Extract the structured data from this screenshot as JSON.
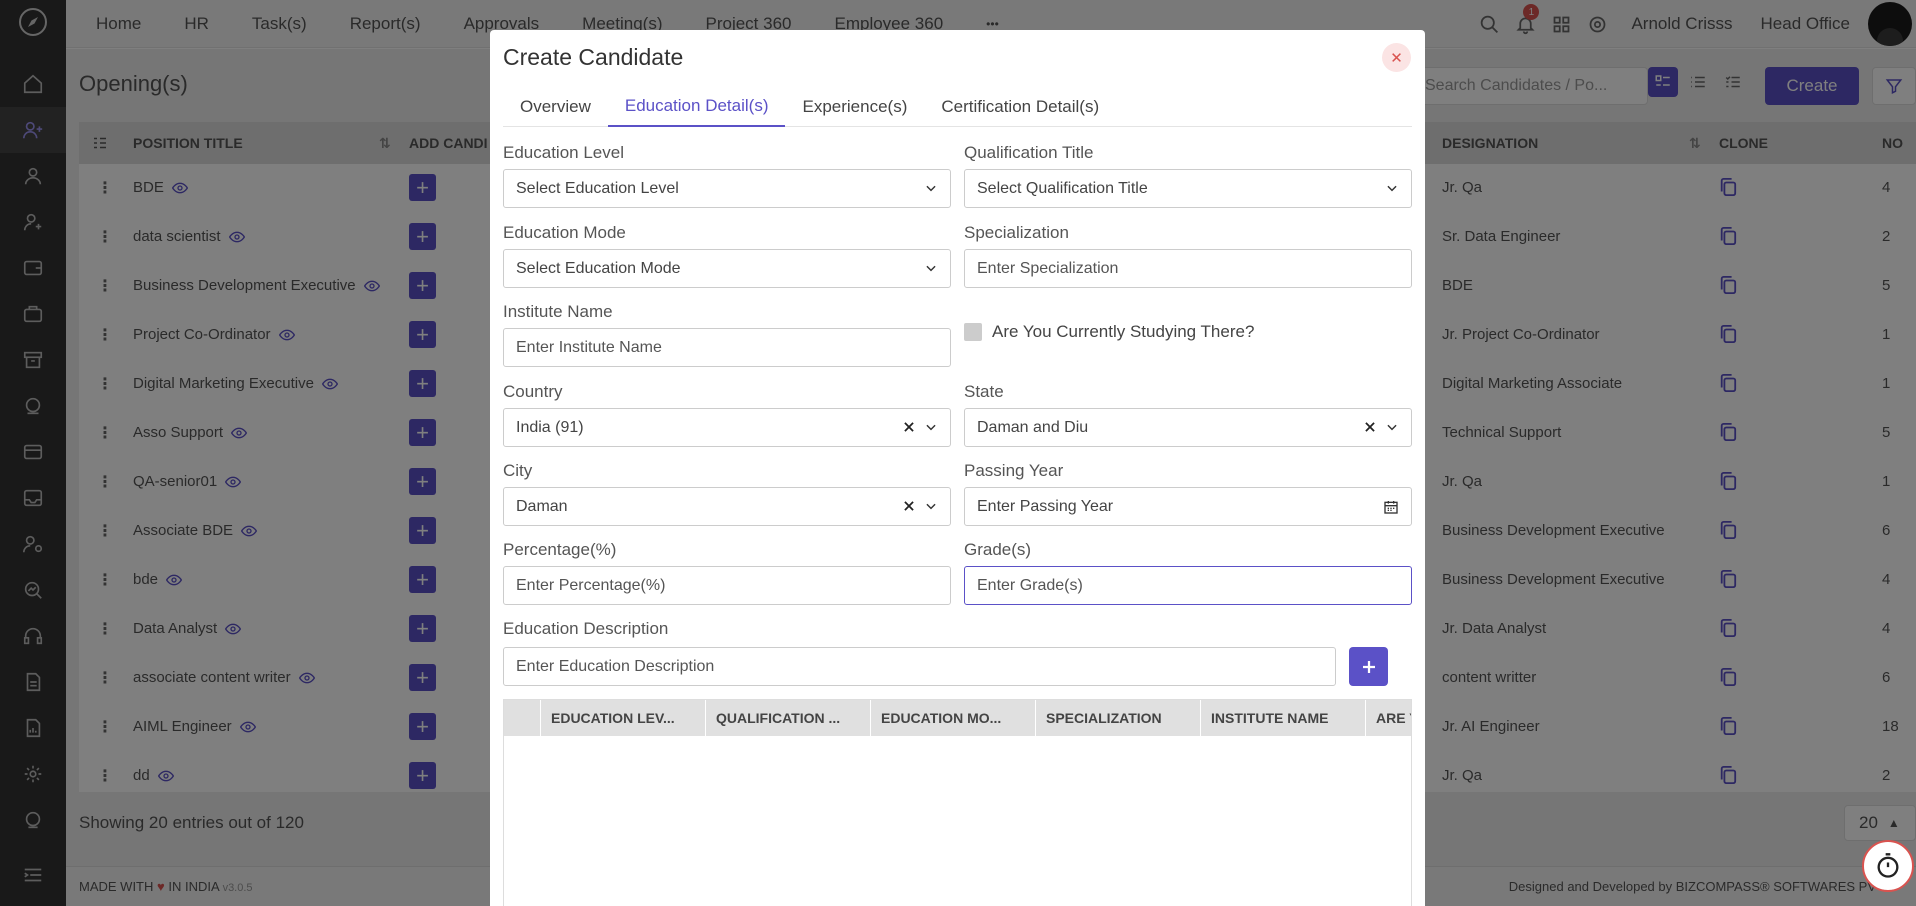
{
  "nav": {
    "items": [
      "Home",
      "HR",
      "Task(s)",
      "Report(s)",
      "Approvals",
      "Meeting(s)",
      "Project 360",
      "Employee 360"
    ],
    "more": "•••"
  },
  "user": {
    "name": "Arnold Crisss",
    "office": "Head Office",
    "notifications": "1"
  },
  "page": {
    "title": "Opening(s)",
    "search_placeholder": "Search Candidates / Po...",
    "create_label": "Create",
    "columns": {
      "position": "POSITION TITLE",
      "add": "ADD CANDI",
      "designation": "DESIGNATION",
      "clone": "CLONE",
      "num": "NO"
    },
    "rows": [
      {
        "title": "BDE",
        "designation": "Jr. Qa",
        "num": "4"
      },
      {
        "title": "data scientist",
        "designation": "Sr. Data Engineer",
        "num": "2"
      },
      {
        "title": "Business Development Executive",
        "designation": "BDE",
        "num": "5"
      },
      {
        "title": "Project Co-Ordinator",
        "designation": "Jr. Project Co-Ordinator",
        "num": "1"
      },
      {
        "title": "Digital Marketing Executive",
        "designation": "Digital Marketing Associate",
        "num": "1"
      },
      {
        "title": "Asso Support",
        "designation": "Technical Support",
        "num": "5"
      },
      {
        "title": "QA-senior01",
        "designation": "Jr. Qa",
        "num": "1"
      },
      {
        "title": "Associate BDE",
        "designation": "Business Development Executive",
        "num": "6"
      },
      {
        "title": "bde",
        "designation": "Business Development Executive",
        "num": "4"
      },
      {
        "title": "Data Analyst",
        "designation": "Jr. Data Analyst",
        "num": "4"
      },
      {
        "title": "associate content writer",
        "designation": "content writter",
        "num": "6"
      },
      {
        "title": "AIML Engineer",
        "designation": "Jr. AI Engineer",
        "num": "18"
      },
      {
        "title": "dd",
        "designation": "Jr. Qa",
        "num": "2"
      }
    ],
    "showing": "Showing 20 entries out of 120",
    "page_size": "20"
  },
  "footer": {
    "left_prefix": "MADE WITH",
    "left_suffix": "IN INDIA",
    "version": "v3.0.5",
    "right": "Designed and Developed by BIZCOMPASS® SOFTWARES PV"
  },
  "modal": {
    "title": "Create Candidate",
    "close": "✕",
    "tabs": [
      "Overview",
      "Education Detail(s)",
      "Experience(s)",
      "Certification Detail(s)"
    ],
    "labels": {
      "education_level": "Education Level",
      "qualification_title": "Qualification Title",
      "education_mode": "Education Mode",
      "specialization": "Specialization",
      "institute_name": "Institute Name",
      "currently_studying": "Are You Currently Studying There?",
      "country": "Country",
      "state": "State",
      "city": "City",
      "passing_year": "Passing Year",
      "percentage": "Percentage(%)",
      "grades": "Grade(s)",
      "description": "Education Description"
    },
    "values": {
      "education_level": "Select Education Level",
      "qualification_title": "Select Qualification Title",
      "education_mode": "Select Education Mode",
      "specialization": "Enter Specialization",
      "institute_name": "Enter Institute Name",
      "country": "India (91)",
      "state": "Daman and Diu",
      "city": "Daman",
      "passing_year": "Enter Passing Year",
      "percentage": "Enter Percentage(%)",
      "grades": "Enter Grade(s)",
      "description": "Enter Education Description"
    },
    "table_headers": [
      "EDUCATION LEV...",
      "QUALIFICATION ...",
      "EDUCATION MO...",
      "SPECIALIZATION",
      "INSTITUTE NAME",
      "ARE Y"
    ]
  }
}
